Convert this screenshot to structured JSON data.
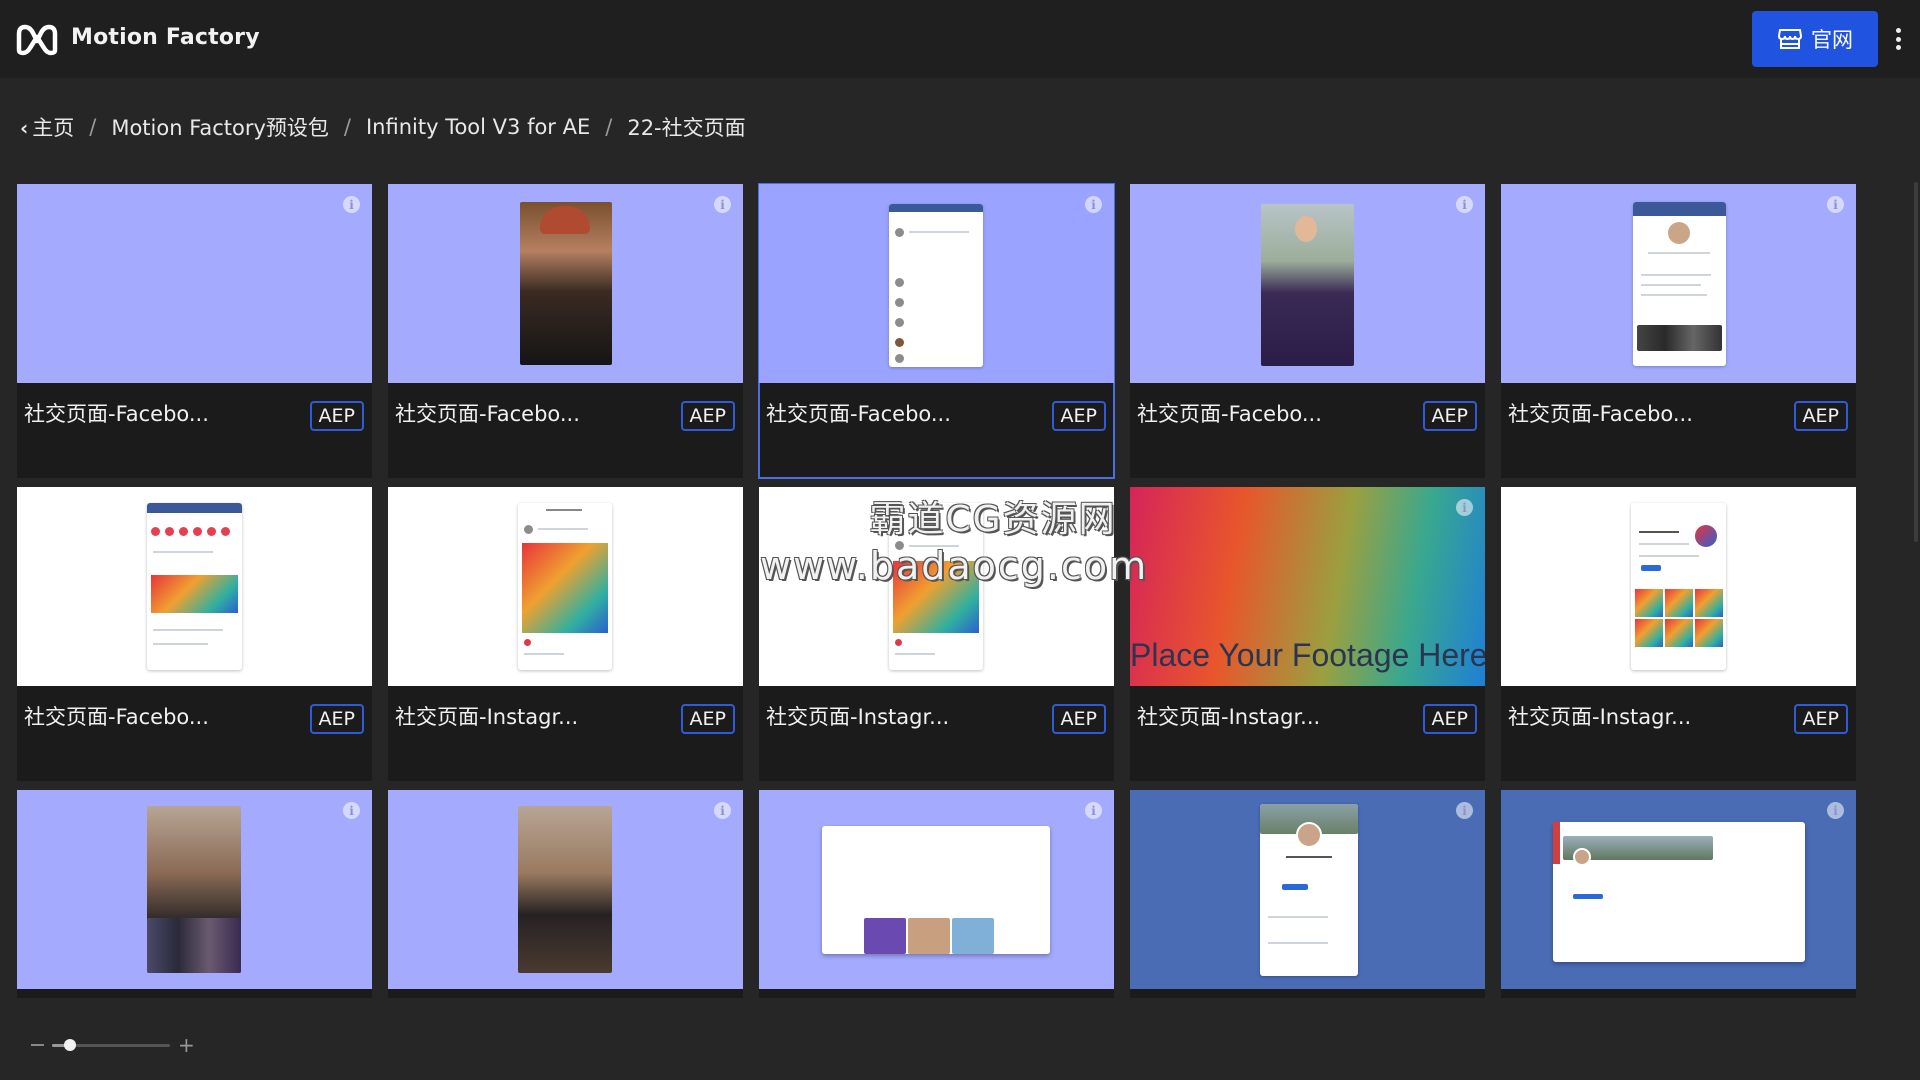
{
  "app": {
    "title": "Motion Factory",
    "logo_icon": "motion-factory-logo",
    "site_button_label": "官网",
    "site_button_icon": "store-icon",
    "accent_color": "#1f53e0"
  },
  "breadcrumb": {
    "items": [
      "主页",
      "Motion Factory预设包",
      "Infinity Tool V3 for AE",
      "22-社交页面"
    ],
    "separator": "/"
  },
  "cards": [
    {
      "title": "社交页面-Facebo...",
      "badge": "AEP",
      "thumb": "blank"
    },
    {
      "title": "社交页面-Facebo...",
      "badge": "AEP",
      "thumb": "man-portrait"
    },
    {
      "title": "社交页面-Facebo...",
      "badge": "AEP",
      "thumb": "facebook-feed",
      "selected": true
    },
    {
      "title": "社交页面-Facebo...",
      "badge": "AEP",
      "thumb": "woman-portrait"
    },
    {
      "title": "社交页面-Facebo...",
      "badge": "AEP",
      "thumb": "facebook-profile"
    },
    {
      "title": "社交页面-Facebo...",
      "badge": "AEP",
      "thumb": "facebook-post"
    },
    {
      "title": "社交页面-Instagr...",
      "badge": "AEP",
      "thumb": "instagram-post"
    },
    {
      "title": "社交页面-Instagr...",
      "badge": "AEP",
      "thumb": "instagram-post-2"
    },
    {
      "title": "社交页面-Instagr...",
      "badge": "AEP",
      "thumb": "footage-gradient",
      "footage_text": "Place Your Footage Here!"
    },
    {
      "title": "社交页面-Instagr...",
      "badge": "AEP",
      "thumb": "instagram-grid"
    },
    {
      "title": "",
      "badge": "",
      "thumb": "story-woman-grid"
    },
    {
      "title": "",
      "badge": "",
      "thumb": "story-woman"
    },
    {
      "title": "",
      "badge": "",
      "thumb": "instagram-desktop"
    },
    {
      "title": "",
      "badge": "",
      "thumb": "linkedin-mobile"
    },
    {
      "title": "",
      "badge": "",
      "thumb": "linkedin-desktop"
    }
  ],
  "watermark": {
    "line1": "霸道CG资源网",
    "line2": "www.badaocg.com"
  },
  "zoom": {
    "minus": "−",
    "plus": "+",
    "level": 0.15
  }
}
